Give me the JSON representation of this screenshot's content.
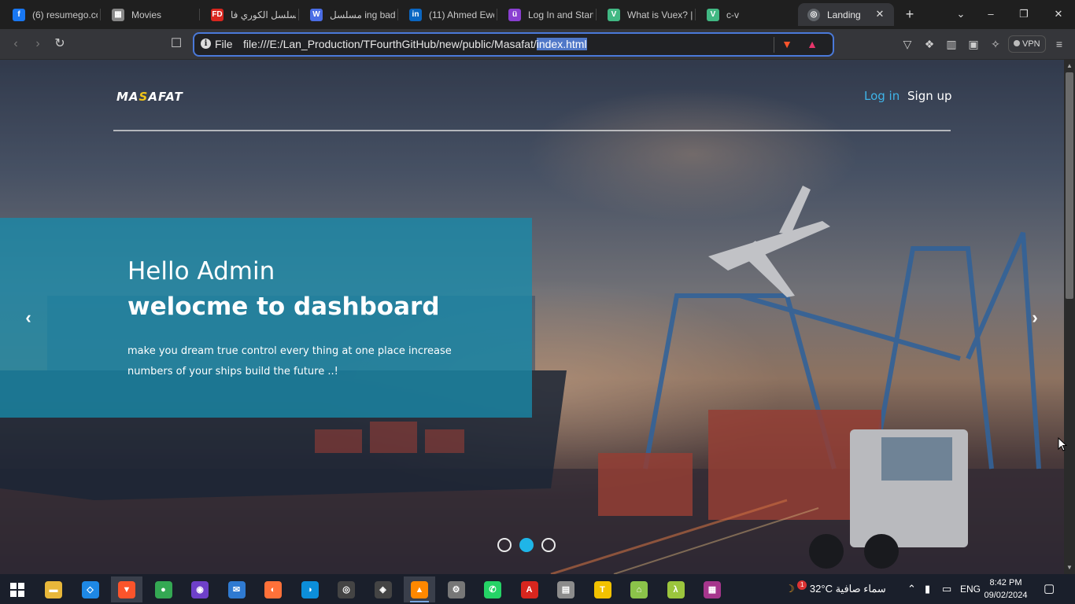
{
  "browser": {
    "tabs": [
      {
        "title": "(6) resumego.co",
        "icon": "facebook-icon",
        "color": "#1877f2",
        "glyph": "f"
      },
      {
        "title": "Movies",
        "icon": "movies-icon",
        "color": "#888888",
        "glyph": "▦"
      },
      {
        "title": "مسلسل الكوري فا",
        "icon": "fd-icon",
        "color": "#d8261e",
        "glyph": "FD"
      },
      {
        "title": "مسلسل ing bad",
        "icon": "w-icon",
        "color": "#4a6de5",
        "glyph": "W"
      },
      {
        "title": "(11) Ahmed Ewe",
        "icon": "linkedin-icon",
        "color": "#0a66c2",
        "glyph": "in"
      },
      {
        "title": "Log In and Start",
        "icon": "app-icon",
        "color": "#8a3fd1",
        "glyph": "ü"
      },
      {
        "title": "What is Vuex? |",
        "icon": "vue-icon",
        "color": "#41b883",
        "glyph": "V"
      },
      {
        "title": "c-v",
        "icon": "vue-icon",
        "color": "#41b883",
        "glyph": "V"
      }
    ],
    "active_tab": {
      "title": "Landing",
      "icon": "globe-icon"
    },
    "address": {
      "scheme": "File",
      "path": "file:///E:/Lan_Production/TFourthGitHub/new/public/Masafat/",
      "selected": "index.html"
    },
    "vpn_label": "VPN"
  },
  "page": {
    "brand_prefix": "MA",
    "brand_accent": "S",
    "brand_suffix": "AFAT",
    "nav": {
      "login": "Log in",
      "signup": "Sign up"
    },
    "hero": {
      "line1": "Hello Admin",
      "line2": "welocme to dashboard",
      "body": "make you dream true control every thing at one place increase numbers of your ships build the future ..!"
    },
    "carousel": {
      "slides": 3,
      "active_index": 1,
      "prev": "‹",
      "next": "›"
    },
    "colors": {
      "accent": "#3fb4e8",
      "caption_bg": "#188aaa",
      "brand_accent": "#f0c419"
    }
  },
  "taskbar": {
    "apps": [
      {
        "name": "file-explorer",
        "color": "#e8b73a",
        "glyph": "▬"
      },
      {
        "name": "vscode",
        "color": "#1e88e5",
        "glyph": "◇"
      },
      {
        "name": "brave",
        "color": "#fb542b",
        "glyph": "▼",
        "active": true
      },
      {
        "name": "chrome",
        "color": "#34a853",
        "glyph": "●"
      },
      {
        "name": "github-desktop",
        "color": "#6e40c9",
        "glyph": "◉"
      },
      {
        "name": "mail",
        "color": "#2f7ad1",
        "glyph": "✉"
      },
      {
        "name": "firefox",
        "color": "#ff7139",
        "glyph": "◐"
      },
      {
        "name": "edge",
        "color": "#0c8ed9",
        "glyph": "◑"
      },
      {
        "name": "obs",
        "color": "#444444",
        "glyph": "◎"
      },
      {
        "name": "resolve",
        "color": "#444444",
        "glyph": "◈"
      },
      {
        "name": "vlc",
        "color": "#ff8800",
        "glyph": "▲",
        "running": true
      },
      {
        "name": "gpu-tool",
        "color": "#777777",
        "glyph": "⚙"
      },
      {
        "name": "whatsapp",
        "color": "#25d366",
        "glyph": "✆"
      },
      {
        "name": "acrobat",
        "color": "#d8261e",
        "glyph": "A"
      },
      {
        "name": "folder-app",
        "color": "#8c8c8c",
        "glyph": "▤"
      },
      {
        "name": "t-app",
        "color": "#f2c200",
        "glyph": "T"
      },
      {
        "name": "android-app",
        "color": "#8bc34a",
        "glyph": "⌂"
      },
      {
        "name": "lambda-app",
        "color": "#9bc53d",
        "glyph": "λ"
      },
      {
        "name": "winrar",
        "color": "#a6368c",
        "glyph": "▦"
      }
    ],
    "weather": {
      "temp": "32°C",
      "desc": "سماء صافية",
      "badge": "1"
    },
    "lang": "ENG",
    "time": "8:42 PM",
    "date": "09/02/2024"
  }
}
